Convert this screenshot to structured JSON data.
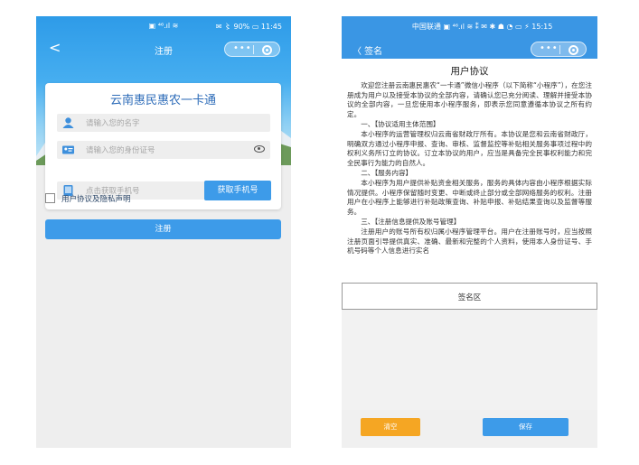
{
  "left": {
    "status_center": "▣ ⁴⁶.ıl ≋",
    "status_right": "✉ 〻 90% ▭ 11:45",
    "nav_title": "注册",
    "card_title": "云南惠民惠农一卡通",
    "name_placeholder": "请输入您的名字",
    "id_placeholder": "请输入您的身份证号",
    "phone_placeholder": "点击获取手机号",
    "get_phone_button": "获取手机号",
    "agreement_label": "用户协议及隐私声明",
    "register_button": "注册"
  },
  "right": {
    "status_center": "中国联通 ▣ ⁴⁶.ıl ≋ ⁑ ✉ ✱ ☗ ◔ ▭ ⚡ 15:15",
    "nav_back_label": "〈 签名",
    "doc_title": "用户协议",
    "paragraphs": [
      "欢迎您注册云南惠民惠农“一卡通”微信小程序（以下简称“小程序”），在您注册成为用户以及接受本协议的全部内容，请确认您已充分阅读、理解并接受本协议的全部内容，一旦您使用本小程序服务，即表示您同意遵循本协议之所有约定。",
      "一、【协议适用主体范围】",
      "本小程序的运营管理权归云南省财政厅所有。本协议是您和云南省财政厅，明确双方通过小程序申报、查询、审核、监督监控等补贴相关服务事项过程中的权利义务所订立的协议。订立本协议的用户，应当是具备完全民事权利能力和完全民事行为能力的自然人。",
      "二、【服务内容】",
      "本小程序为用户提供补贴资金相关服务，服务的具体内容由小程序根据实际情况提供。小程序保留随时变更、中断或终止部分或全部网络服务的权利。注册用户在小程序上能够进行补贴政策查询、补贴申报、补贴结果查询以及监督等服务。",
      "三、【注册信息提供及账号管理】",
      "注册用户的账号所有权归属小程序管理平台。用户在注册账号时，应当按照注册页面引导提供真实、准确、最新和完整的个人资料，使用本人身份证号、手机号码等个人信息进行实名"
    ],
    "signature_area_label": "签名区",
    "clear_button": "清空",
    "save_button": "保存"
  },
  "colors": {
    "accent": "#3d9be9",
    "orange": "#f5a623",
    "card_title": "#2c6bb8"
  },
  "icons": [
    "back-icon",
    "more-dots-icon",
    "close-circle-icon",
    "user-icon",
    "id-card-icon",
    "phone-icon",
    "eye-icon",
    "checkbox-icon"
  ]
}
